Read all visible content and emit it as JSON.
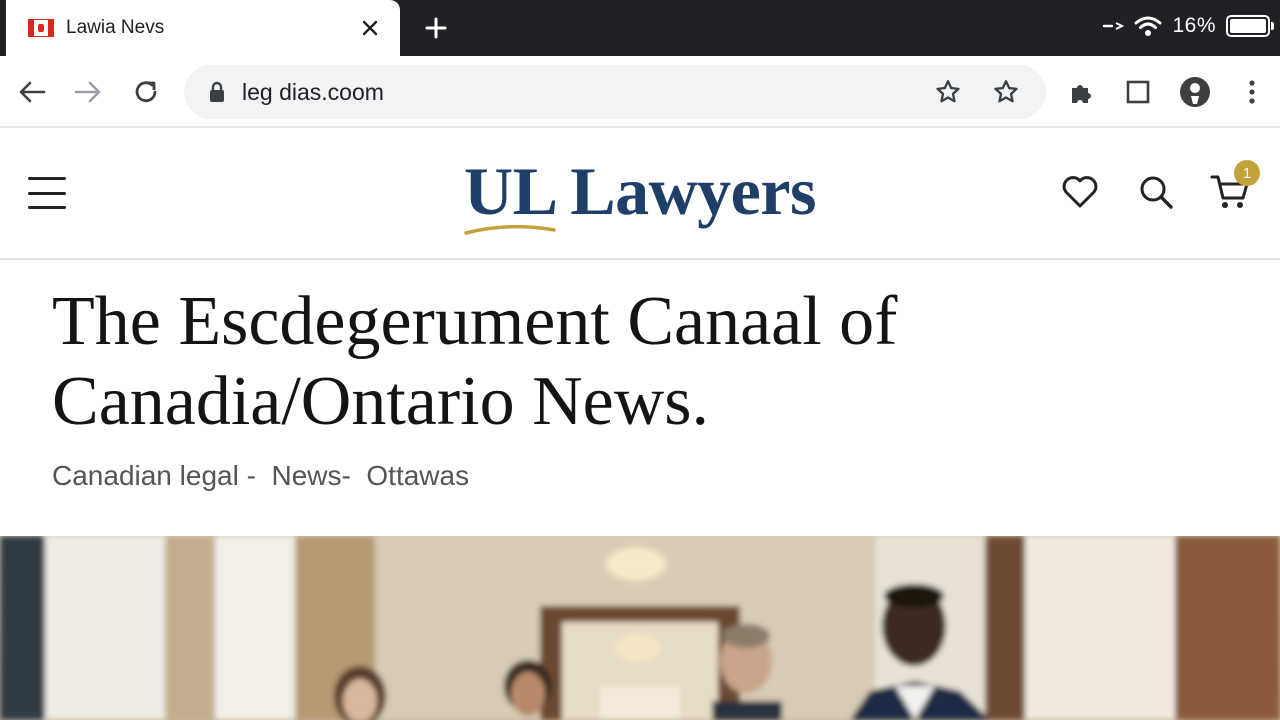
{
  "browser": {
    "tab": {
      "title": "Lawia Nevs"
    },
    "status": {
      "battery_percent": "16%"
    },
    "address": {
      "url": "leg dias.coom"
    },
    "icons": {
      "favicon": "canada-flag-icon",
      "close": "close-icon",
      "new_tab": "plus-icon",
      "signal": "signal-icon",
      "wifi": "wifi-icon",
      "battery": "battery-icon",
      "back": "back-arrow-icon",
      "forward": "forward-arrow-icon",
      "reload": "reload-icon",
      "lock": "lock-icon",
      "star": "star-icon",
      "extensions": "puzzle-icon",
      "tab_switcher": "square-icon",
      "profile": "profile-icon",
      "menu": "kebab-menu-icon"
    }
  },
  "site": {
    "logo": "UL Lawyers",
    "cart_count": "1",
    "colors": {
      "brand_navy": "#1f3f69",
      "accent_gold": "#c4a23a"
    }
  },
  "article": {
    "headline": "The Escdegerument Canaal of Canadia/Ontario News.",
    "breadcrumbs": [
      "Canadian legal - ",
      " News- ",
      " Ottawas"
    ]
  },
  "hero": {
    "description_icon": "office-hallway-photo"
  }
}
